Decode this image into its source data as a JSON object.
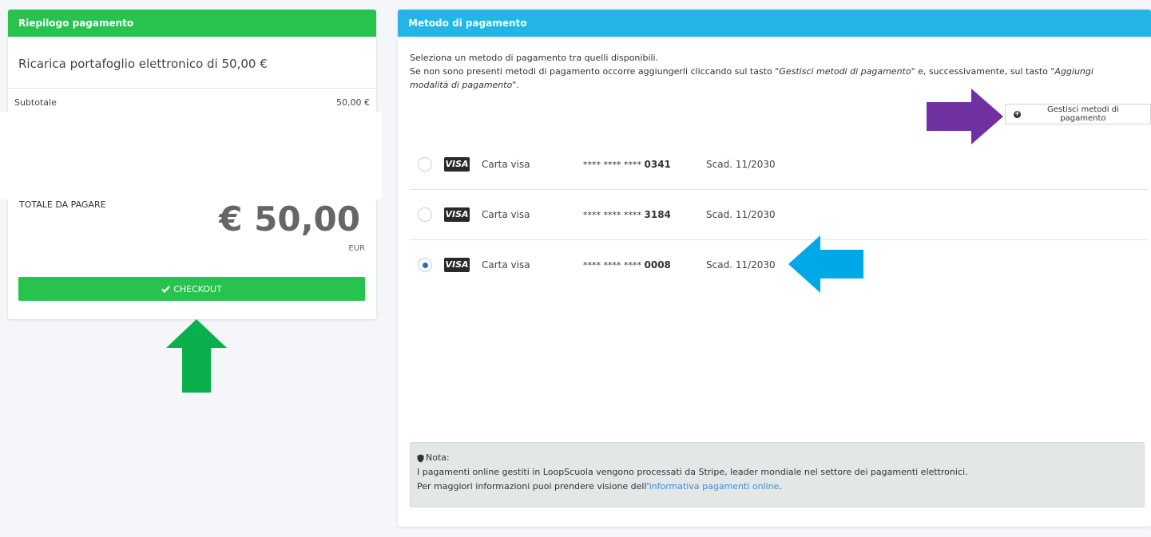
{
  "summary": {
    "header": "Riepilogo pagamento",
    "title": "Ricarica portafoglio elettronico di 50,00 €",
    "subtotal_label": "Subtotale",
    "subtotal_value": "50,00 €",
    "total_label": "TOTALE DA PAGARE",
    "total_amount": "€ 50,00",
    "currency": "EUR",
    "checkout_label": "CHECKOUT"
  },
  "methods": {
    "header": "Metodo di pagamento",
    "intro_line1": "Seleziona un metodo di pagamento tra quelli disponibili.",
    "intro_line2_a": "Se non sono presenti metodi di pagamento occorre aggiungerli cliccando sul tasto ",
    "intro_line2_b": "\"Gestisci metodi di pagamento\"",
    "intro_line2_c": " e, successivamente, sul tasto ",
    "intro_line2_d": "\"Aggiungi modalità di pagamento\"",
    "intro_line2_e": ".",
    "manage_label": "Gestisci metodi di pagamento",
    "cards": [
      {
        "brand": "VISA",
        "name": "Carta visa",
        "mask": "**** **** ****",
        "last4": "0341",
        "expiry": "Scad. 11/2030",
        "selected": false
      },
      {
        "brand": "VISA",
        "name": "Carta visa",
        "mask": "**** **** ****",
        "last4": "3184",
        "expiry": "Scad. 11/2030",
        "selected": false
      },
      {
        "brand": "VISA",
        "name": "Carta visa",
        "mask": "**** **** ****",
        "last4": "0008",
        "expiry": "Scad. 11/2030",
        "selected": true
      }
    ]
  },
  "note": {
    "title": "Nota:",
    "line1": "I pagamenti online gestiti in LoopScuola vengono processati da Stripe, leader mondiale nel settore dei pagamenti elettronici.",
    "line2_prefix": "Per maggiori informazioni puoi prendere visione dell'",
    "line2_link": "informativa pagamenti online",
    "line2_suffix": "."
  },
  "colors": {
    "summary_header": "#28c24f",
    "methods_header": "#22b5e5",
    "arrow_green": "#0ab04b",
    "arrow_purple": "#7030a0",
    "arrow_blue": "#00a8e8"
  }
}
